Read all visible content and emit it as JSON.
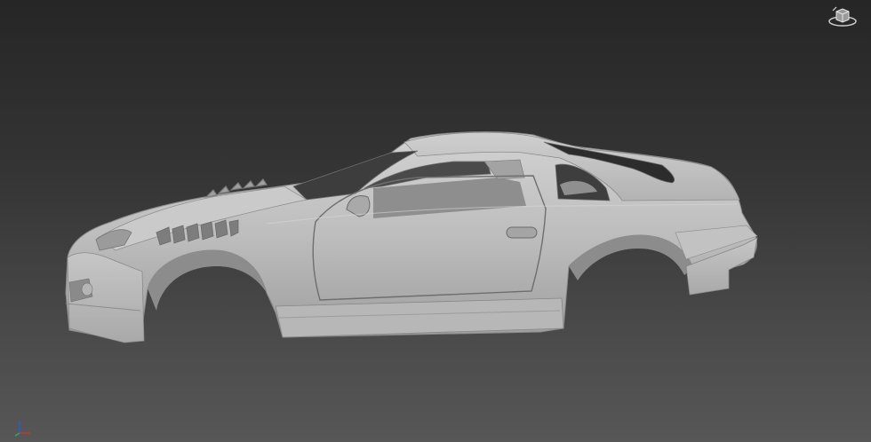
{
  "viewport": {
    "background_top": "#262626",
    "background_bottom": "#575757",
    "model": {
      "type": "car-body-shell",
      "color": "#bdbdbd"
    }
  },
  "viewcube": {
    "icon": "viewcube-home-icon"
  },
  "axis_tripod": {
    "icon": "axis-tripod-icon",
    "colors": {
      "x": "#c0392b",
      "y": "#27ae60",
      "z": "#2c5ccc"
    }
  }
}
